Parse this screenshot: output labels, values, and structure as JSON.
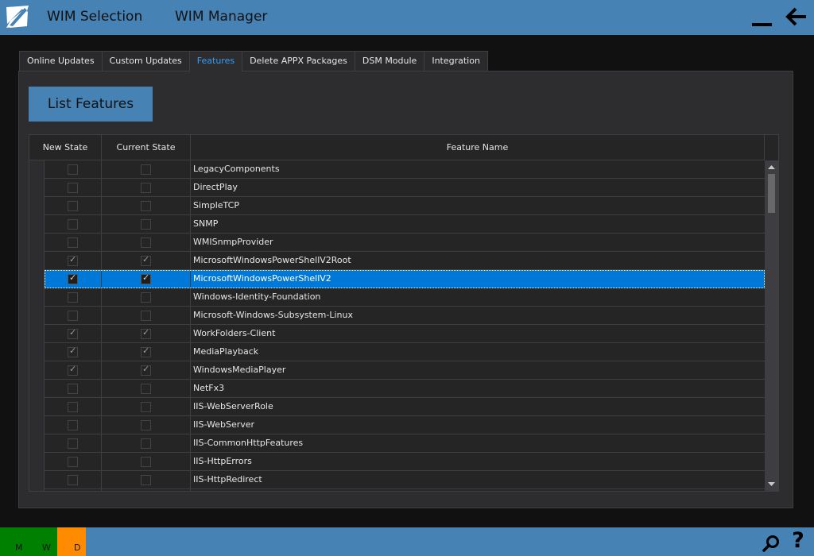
{
  "titlebar": {
    "logo_icon": "app-logo-icon",
    "nav": [
      "WIM Selection",
      "WIM Manager"
    ],
    "minimize_icon": "minimize-icon",
    "back_icon": "arrow-left-icon"
  },
  "tabs": [
    {
      "label": "Online Updates",
      "active": false
    },
    {
      "label": "Custom Updates",
      "active": false
    },
    {
      "label": "Features",
      "active": true
    },
    {
      "label": "Delete APPX Packages",
      "active": false
    },
    {
      "label": "DSM Module",
      "active": false
    },
    {
      "label": "Integration",
      "active": false
    }
  ],
  "colors": {
    "accent": "#4682b4",
    "active_tab_text": "#3a9bf0",
    "selection": "#0078d7",
    "status_green": "#008000",
    "status_orange": "#ff8c00"
  },
  "features_panel": {
    "list_button_label": "List Features",
    "columns": [
      "New State",
      "Current State",
      "Feature Name"
    ],
    "rows": [
      {
        "new_state": false,
        "current_state": false,
        "name": "LegacyComponents"
      },
      {
        "new_state": false,
        "current_state": false,
        "name": "DirectPlay"
      },
      {
        "new_state": false,
        "current_state": false,
        "name": "SimpleTCP"
      },
      {
        "new_state": false,
        "current_state": false,
        "name": "SNMP"
      },
      {
        "new_state": false,
        "current_state": false,
        "name": "WMISnmpProvider"
      },
      {
        "new_state": true,
        "current_state": true,
        "name": "MicrosoftWindowsPowerShellV2Root"
      },
      {
        "new_state": true,
        "current_state": true,
        "name": "MicrosoftWindowsPowerShellV2",
        "selected": true
      },
      {
        "new_state": false,
        "current_state": false,
        "name": "Windows-Identity-Foundation"
      },
      {
        "new_state": false,
        "current_state": false,
        "name": "Microsoft-Windows-Subsystem-Linux"
      },
      {
        "new_state": true,
        "current_state": true,
        "name": "WorkFolders-Client"
      },
      {
        "new_state": true,
        "current_state": true,
        "name": "MediaPlayback"
      },
      {
        "new_state": true,
        "current_state": true,
        "name": "WindowsMediaPlayer"
      },
      {
        "new_state": false,
        "current_state": false,
        "name": "NetFx3"
      },
      {
        "new_state": false,
        "current_state": false,
        "name": "IIS-WebServerRole"
      },
      {
        "new_state": false,
        "current_state": false,
        "name": "IIS-WebServer"
      },
      {
        "new_state": false,
        "current_state": false,
        "name": "IIS-CommonHttpFeatures"
      },
      {
        "new_state": false,
        "current_state": false,
        "name": "IIS-HttpErrors"
      },
      {
        "new_state": false,
        "current_state": false,
        "name": "IIS-HttpRedirect"
      },
      {
        "new_state": false,
        "current_state": false,
        "name": ""
      }
    ]
  },
  "statusbar": {
    "indicators": [
      "M",
      "W",
      "D"
    ],
    "search_icon": "search-icon",
    "help_label": "?"
  }
}
